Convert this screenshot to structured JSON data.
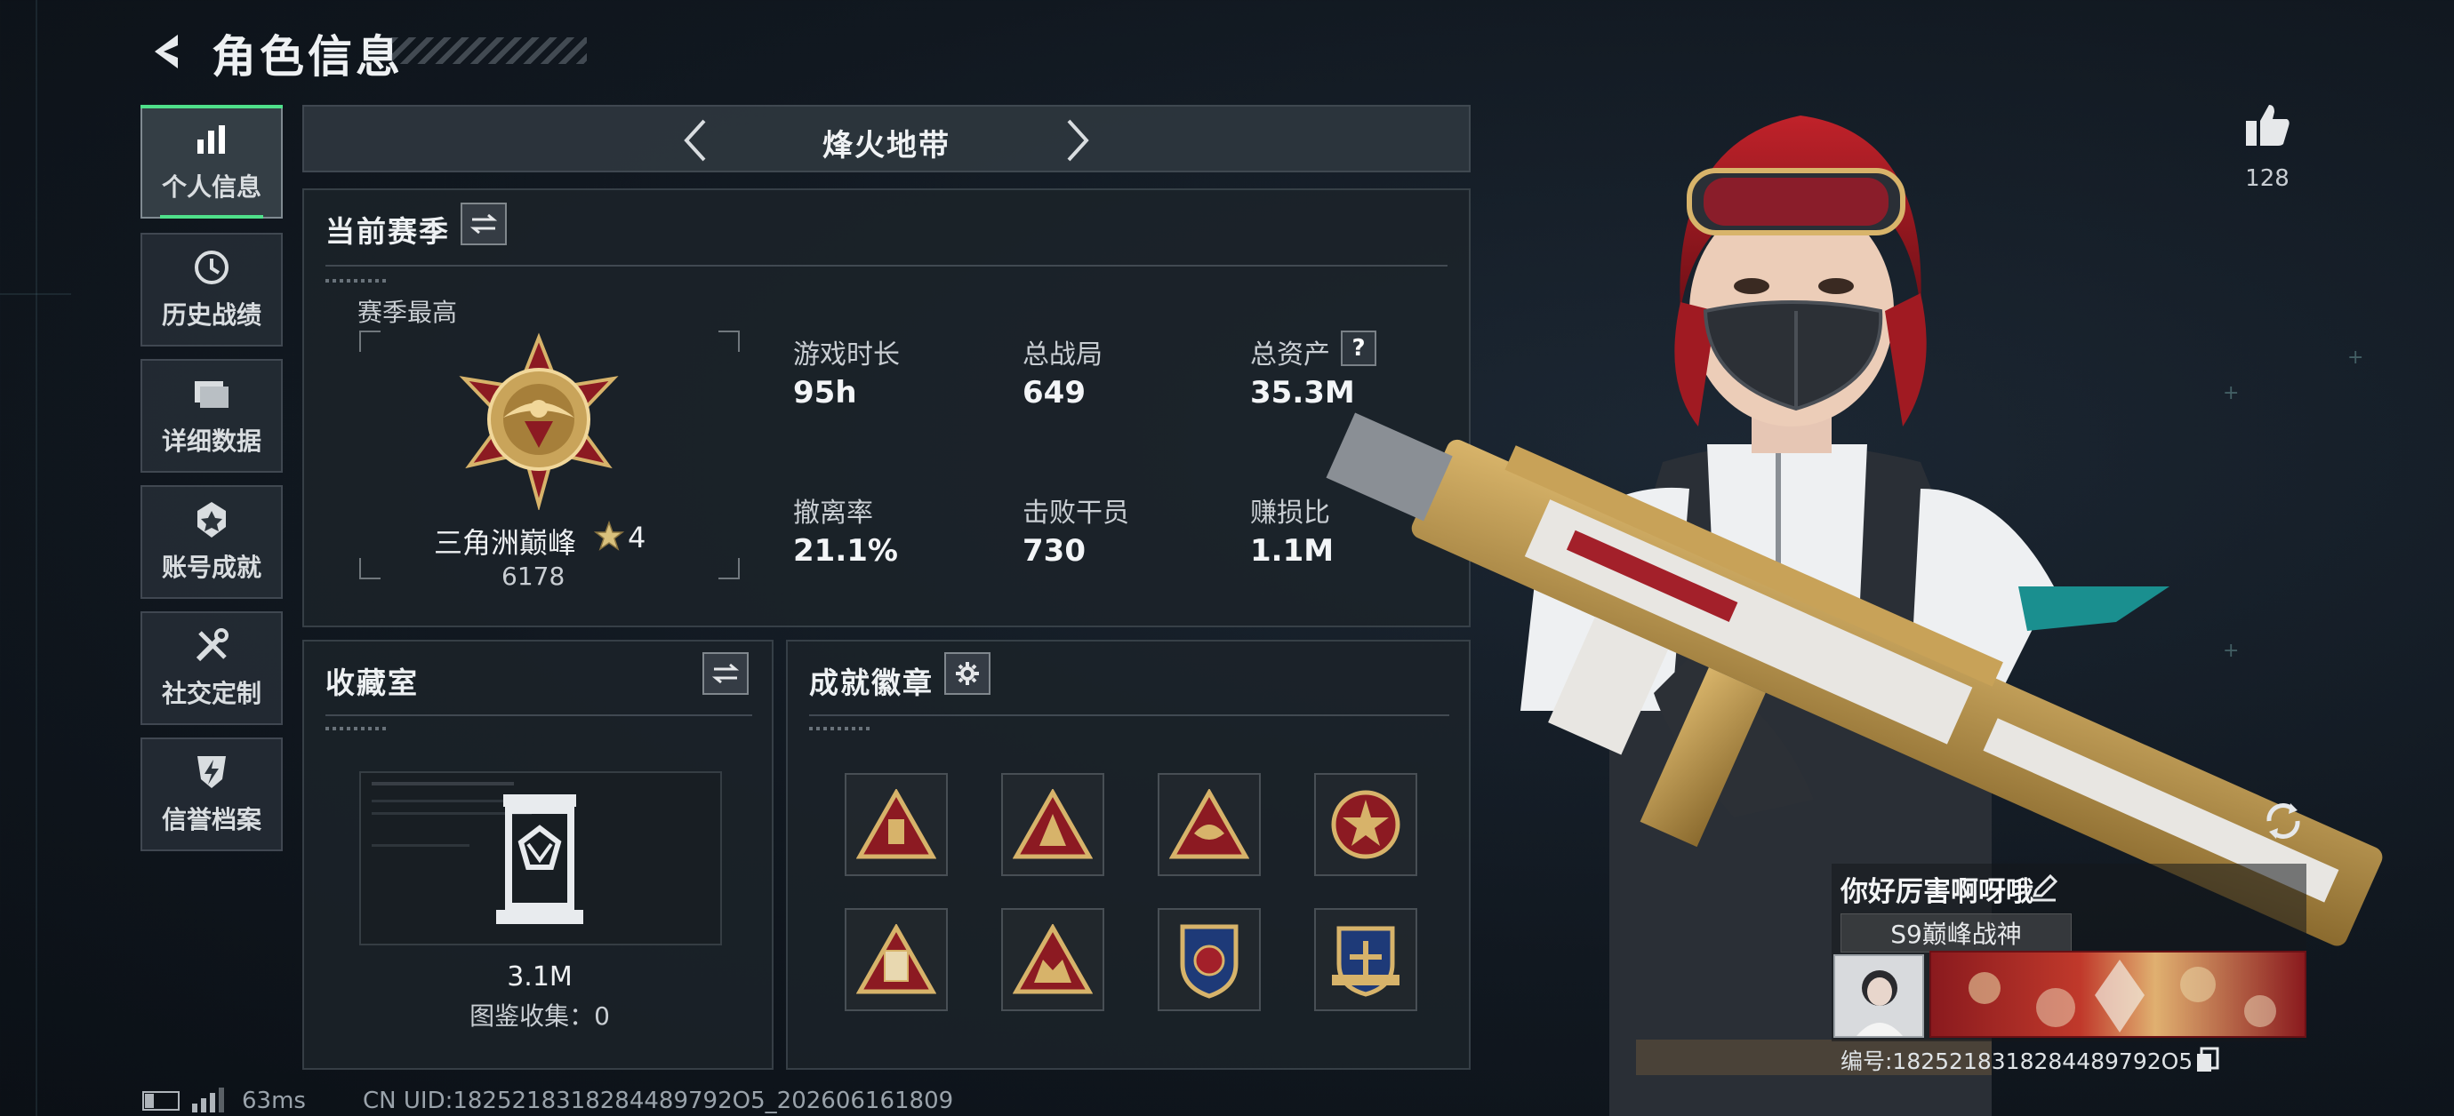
{
  "header": {
    "title": "角色信息"
  },
  "sidebar": {
    "items": [
      {
        "label": "个人信息",
        "icon": "bar-chart-icon",
        "active": true
      },
      {
        "label": "历史战绩",
        "icon": "clock-icon",
        "active": false
      },
      {
        "label": "详细数据",
        "icon": "folder-icon",
        "active": false
      },
      {
        "label": "账号成就",
        "icon": "medal-icon",
        "active": false
      },
      {
        "label": "社交定制",
        "icon": "tools-icon",
        "active": false
      },
      {
        "label": "信誉档案",
        "icon": "shield-bolt-icon",
        "active": false
      }
    ]
  },
  "mode_selector": {
    "label": "烽火地带"
  },
  "season_panel": {
    "title": "当前赛季",
    "best_label": "赛季最高",
    "rank_name": "三角洲巅峰",
    "rank_stars": "4",
    "rank_score": "6178",
    "stats": [
      {
        "label": "游戏时长",
        "value": "95h"
      },
      {
        "label": "总战局",
        "value": "649"
      },
      {
        "label": "总资产",
        "value": "35.3M",
        "help": "?"
      },
      {
        "label": "撤离率",
        "value": "21.1%"
      },
      {
        "label": "击败干员",
        "value": "730"
      },
      {
        "label": "赚损比",
        "value": "1.1M"
      }
    ]
  },
  "collection_panel": {
    "title": "收藏室",
    "value": "3.1M",
    "catalog_text": "图鉴收集：0"
  },
  "achievement_panel": {
    "title": "成就徽章",
    "badges": [
      "triangle-badge-icon",
      "triangle-badge-icon",
      "triangle-badge-icon",
      "round-badge-icon",
      "triangle-badge-icon",
      "triangle-badge-icon",
      "shield-badge-icon",
      "shield-badge-icon"
    ]
  },
  "profile": {
    "like_count": "128",
    "player_name": "你好厉害啊呀哦",
    "title_tag": "S9巅峰战神",
    "player_id": "编号:1825218318284489792O5"
  },
  "status_bar": {
    "ping": "63ms",
    "uid": "CN UID:1825218318284489792O5_202606161809"
  },
  "colors": {
    "accent": "#4fe08a",
    "panel": "#1c232a",
    "gold": "#c9a45a",
    "red": "#a3202a"
  }
}
